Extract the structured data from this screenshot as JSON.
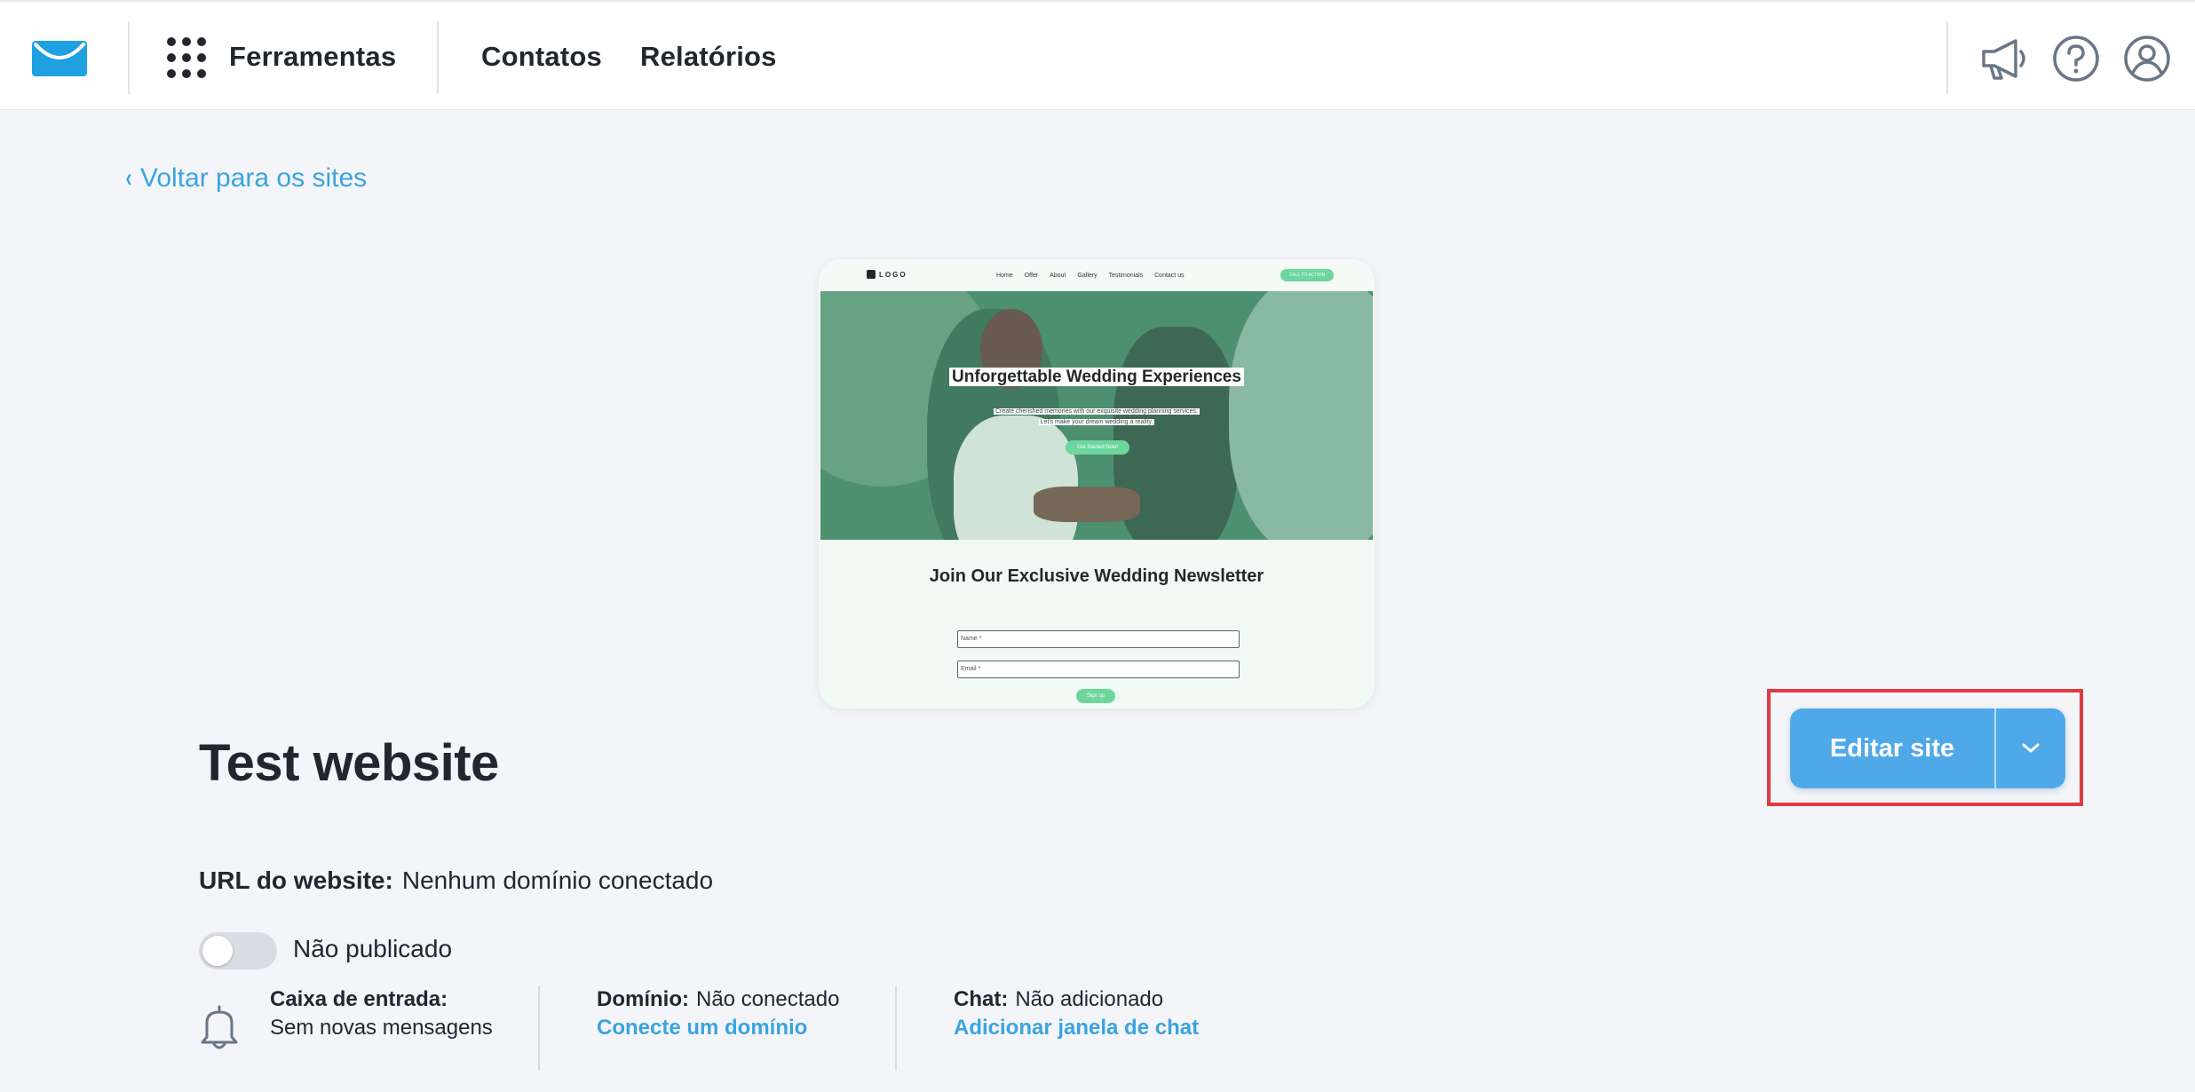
{
  "header": {
    "tools_label": "Ferramentas",
    "nav": [
      "Contatos",
      "Relatórios"
    ],
    "icons": [
      "megaphone-icon",
      "help-icon",
      "user-icon"
    ]
  },
  "back_link": "Voltar para os sites",
  "preview": {
    "logo": "LOGO",
    "links": [
      "Home",
      "Offer",
      "About",
      "Gallery",
      "Testimonials",
      "Contact us"
    ],
    "cta": "CALL TO ACTION",
    "hero_title": "Unforgettable Wedding Experiences",
    "hero_sub_1": "Create cherished memories with our exquisite wedding planning services.",
    "hero_sub_2": "Let's make your dream wedding a reality.",
    "hero_button": "Get Started Now!",
    "newsletter_title": "Join Our Exclusive Wedding Newsletter",
    "name_placeholder": "Name *",
    "email_placeholder": "Email *",
    "signup": "Sign up"
  },
  "site": {
    "title": "Test website",
    "url_label": "URL do website:",
    "url_value": "Nenhum domínio conectado",
    "status": "Não publicado",
    "published": false
  },
  "info": {
    "inbox_label": "Caixa de entrada:",
    "inbox_value": "Sem novas mensagens",
    "domain_label": "Domínio:",
    "domain_value": "Não conectado",
    "domain_link": "Conecte um domínio",
    "chat_label": "Chat:",
    "chat_value": "Não adicionado",
    "chat_link": "Adicionar janela de chat"
  },
  "actions": {
    "edit_label": "Editar site"
  },
  "colors": {
    "accent": "#3ba3e0",
    "button": "#4fa9e8",
    "highlight": "#e13a3f",
    "brand": "#1fa0e1"
  }
}
